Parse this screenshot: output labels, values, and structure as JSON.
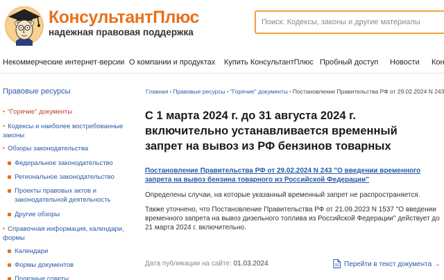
{
  "header": {
    "brand_name": "КонсультантПлюс",
    "brand_tagline": "надежная правовая поддержка",
    "logo_icon": "professor-mascot-icon",
    "search_placeholder": "Поиск: Кодексы, законы и другие материалы"
  },
  "topnav": {
    "items": [
      "Некоммерческие интернет-версии",
      "О компании и продуктах",
      "Купить КонсультантПлюс",
      "Пробный доступ",
      "Новости",
      "Кон"
    ]
  },
  "sidebar": {
    "title": "Правовые ресурсы",
    "items": {
      "hot_docs": "\"Горячие\" документы",
      "codes": "Кодексы и наиболее востребованные законы",
      "reviews": "Обзоры законодательства",
      "federal": "Федеральное законодательство",
      "regional": "Региональное законодательство",
      "projects": "Проекты правовых актов и законодательной деятельность",
      "other_reviews": "Другие обзоры",
      "reference": "Справочная информация, календари, формы",
      "calendars": "Календари",
      "doc_forms": "Формы документов",
      "useful_tips": "Полезные советы"
    }
  },
  "breadcrumb": {
    "home": "Главная",
    "legal": "Правовые ресурсы",
    "hot": "\"Горячие\" документы",
    "current": "Постановление Правительства РФ от 29.02.2024 N 243"
  },
  "article": {
    "title": "С 1 марта 2024 г. до 31 августа 2024 г. включительно устанавливается временный запрет на вывоз из РФ бензинов товарных",
    "doc_link": "Постановление Правительства РФ от 29.02.2024 N 243 \"О введении временного запрета на вывоз бензина товарного из Российской Федерации\"",
    "para1": "Определены случаи, на которые указанный временный запрет не распространяется.",
    "para2": "Также уточнено, что Постановление Правительства РФ от 21.09.2023 N 1537 \"О введении временного запрета на вывоз дизельного топлива из Российской Федерации\" действует до 21 марта 2024 г. включительно.",
    "pub_label": "Дата публикации на сайте:",
    "pub_date": "01.03.2024",
    "go_to_doc": "Перейти в текст документа →"
  },
  "colors": {
    "brand_orange": "#e8711c",
    "link_blue": "#2a5aa8",
    "search_border": "#f0a13a"
  }
}
